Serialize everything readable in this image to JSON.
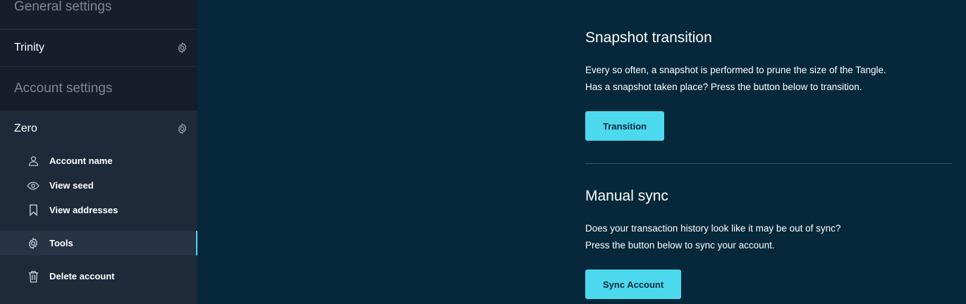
{
  "sidebar": {
    "general_heading": "General settings",
    "wallet_item": "Trinity",
    "account_heading": "Account settings",
    "account_name": "Zero",
    "items": [
      {
        "label": "Account name",
        "icon": "user-icon"
      },
      {
        "label": "View seed",
        "icon": "eye-icon"
      },
      {
        "label": "View addresses",
        "icon": "bookmark-icon"
      },
      {
        "label": "Tools",
        "icon": "gear-icon",
        "active": true
      },
      {
        "label": "Delete account",
        "icon": "trash-icon"
      }
    ]
  },
  "main": {
    "snapshot": {
      "title": "Snapshot transition",
      "line1": "Every so often, a snapshot is performed to prune the size of the Tangle.",
      "line2": "Has a snapshot taken place? Press the button below to transition.",
      "button": "Transition"
    },
    "sync": {
      "title": "Manual sync",
      "line1": "Does your transaction history look like it may be out of sync?",
      "line2": "Press the button below to sync your account.",
      "button": "Sync Account"
    }
  },
  "colors": {
    "background": "#06283a",
    "sidebar": "#1e2a39",
    "accent": "#4cd9ee"
  }
}
